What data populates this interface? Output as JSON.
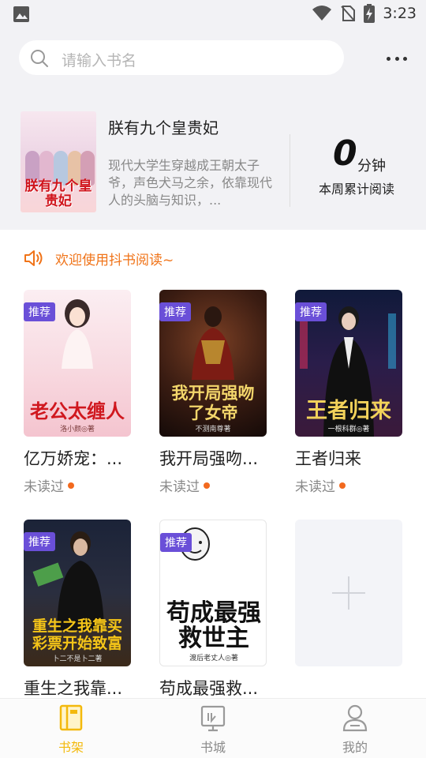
{
  "status_bar": {
    "time": "3:23",
    "icons": [
      "gallery-icon",
      "wifi-icon",
      "no-sim-icon",
      "battery-charging-icon"
    ]
  },
  "search": {
    "placeholder": "请输入书名",
    "icon": "search-icon"
  },
  "more_button_icon": "more-dots-icon",
  "featured": {
    "title": "朕有九个皇贵妃",
    "description": "现代大学生穿越成王朝太子爷，声色犬马之余，依靠现代人的头脑与知识，...",
    "cover_title": "朕有九个皇贵妃",
    "minutes_value": "0",
    "minutes_unit": "分钟",
    "minutes_caption": "本周累计阅读"
  },
  "welcome": {
    "icon": "speaker-icon",
    "text": "欢迎使用抖书阅读~"
  },
  "badge_label": "推荐",
  "books": [
    {
      "title": "亿万娇宠：...",
      "status": "未读过",
      "recommended": true,
      "cover_title": "老公太缠人",
      "cover_author": "洛小颜◎著"
    },
    {
      "title": "我开局强吻...",
      "status": "未读过",
      "recommended": true,
      "cover_title": "我开局强吻了女帝",
      "cover_author": "不测南尊著"
    },
    {
      "title": "王者归来",
      "status": "未读过",
      "recommended": true,
      "cover_title": "王者归来",
      "cover_author": "一根科群◎著"
    },
    {
      "title": "重生之我靠...",
      "status": "",
      "recommended": true,
      "cover_title": "重生之我靠买彩票开始致富",
      "cover_author": "卜二不是卜二著"
    },
    {
      "title": "苟成最强救...",
      "status": "",
      "recommended": true,
      "cover_title": "苟成最强救世主",
      "cover_author": "渡后老丈人◎著"
    }
  ],
  "add_book_icon": "plus-icon",
  "nav": [
    {
      "label": "书架",
      "icon": "bookshelf-icon",
      "active": true
    },
    {
      "label": "书城",
      "icon": "bookstore-icon",
      "active": false
    },
    {
      "label": "我的",
      "icon": "profile-icon",
      "active": false
    }
  ],
  "colors": {
    "accent": "#f3b90c",
    "welcome_orange": "#f07318",
    "badge_purple": "#6a4fd8",
    "unread_dot": "#f2691e",
    "top_bg": "#f2f2f5"
  }
}
